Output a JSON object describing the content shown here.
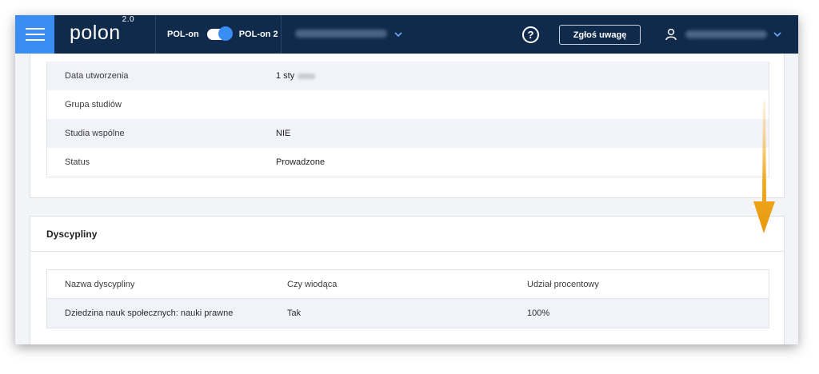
{
  "header": {
    "logo_text": "polon",
    "logo_version": "2.0",
    "toggle_left_label": "POL-on",
    "toggle_right_label": "POL-on 2",
    "report_button_label": "Zgłoś uwagę",
    "help_symbol": "?"
  },
  "details": {
    "rows": [
      {
        "key": "Data utworzenia",
        "value": "1 sty"
      },
      {
        "key": "Grupa studiów",
        "value": ""
      },
      {
        "key": "Studia wspólne",
        "value": "NIE"
      },
      {
        "key": "Status",
        "value": "Prowadzone"
      }
    ]
  },
  "disciplines": {
    "title": "Dyscypliny",
    "columns": [
      "Nazwa dyscypliny",
      "Czy wiodąca",
      "Udział procentowy"
    ],
    "rows": [
      {
        "name": "Dziedzina nauk społecznych: nauki prawne",
        "leading": "Tak",
        "share": "100%"
      }
    ]
  },
  "colors": {
    "topbar": "#0f2a4a",
    "accent": "#3a8df2",
    "arrow": "#f0a81c"
  },
  "icons": [
    "menu-icon",
    "chevron-down-icon",
    "help-icon",
    "user-icon",
    "arrow-down-icon"
  ]
}
